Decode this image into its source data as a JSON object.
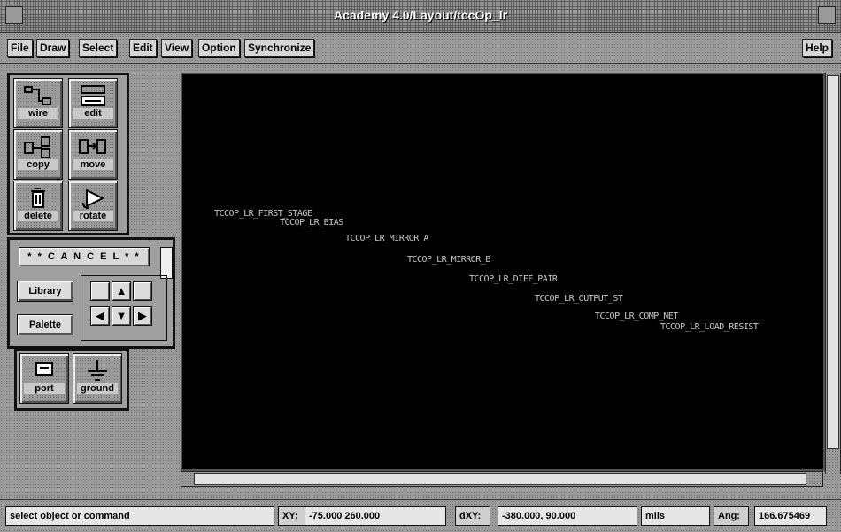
{
  "window": {
    "title": "Academy 4.0/Layout/tccOp_lr"
  },
  "menubar": {
    "items": [
      {
        "label": "File"
      },
      {
        "label": "Draw"
      },
      {
        "label": "Select"
      },
      {
        "label": "Edit"
      },
      {
        "label": "View"
      },
      {
        "label": "Option"
      },
      {
        "label": "Synchronize"
      }
    ],
    "help": "Help"
  },
  "toolbox": {
    "tools": [
      {
        "label": "wire",
        "icon": "wire-icon"
      },
      {
        "label": "edit",
        "icon": "edit-icon"
      },
      {
        "label": "copy",
        "icon": "copy-icon"
      },
      {
        "label": "move",
        "icon": "move-icon"
      },
      {
        "label": "delete",
        "icon": "trash-icon"
      },
      {
        "label": "rotate",
        "icon": "rotate-icon"
      }
    ],
    "cancel_label": "* * C A N C E L * *",
    "library_label": "Library",
    "palette_label": "Palette",
    "components": [
      {
        "label": "port",
        "icon": "port-icon"
      },
      {
        "label": "ground",
        "icon": "ground-icon"
      }
    ]
  },
  "canvas": {
    "background": "#000000",
    "labels": [
      "TCCOP_LR_FIRST_STAGE",
      "TCCOP_LR_BIAS",
      "TCCOP_LR_MIRROR_A",
      "TCCOP_LR_MIRROR_B",
      "TCCOP_LR_DIFF_PAIR",
      "TCCOP_LR_OUTPUT_ST",
      "TCCOP_LR_COMP_NET",
      "TCCOP_LR_LOAD_RESIST"
    ]
  },
  "statusbar": {
    "prompt": "select object or command",
    "xy_label": "XY:",
    "xy_value": "-75.000 260.000",
    "dxy_label": "dXY:",
    "dxy_value": "-380.000, 90.000",
    "units": "mils",
    "ang_label": "Ang:",
    "ang_value": "166.675469"
  }
}
